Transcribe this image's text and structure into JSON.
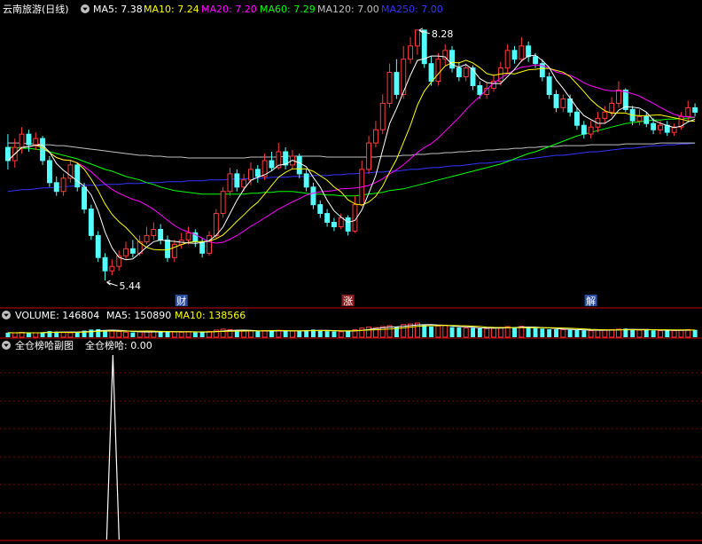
{
  "main": {
    "title": "云南旅游(日线)",
    "indicators": [
      {
        "label": "MA5: 7.38",
        "color": "#ffffff"
      },
      {
        "label": "MA10: 7.24",
        "color": "#ffff00"
      },
      {
        "label": "MA20: 7.20",
        "color": "#ff00ff"
      },
      {
        "label": "MA60: 7.29",
        "color": "#00ff00"
      },
      {
        "label": "MA120: 7.00",
        "color": "#c0c0c0"
      },
      {
        "label": "MA250: 7.00",
        "color": "#3333ff"
      }
    ],
    "high_label": "8.28",
    "low_label": "5.44",
    "markers": [
      {
        "text": "财",
        "bg": "#2b4f9e"
      },
      {
        "text": "涨",
        "bg": "#8b1e1e"
      },
      {
        "text": "解",
        "bg": "#2b4f9e"
      }
    ]
  },
  "volume": {
    "title": "VOLUME: 146804",
    "ma5": "MA5: 150890",
    "ma10": "MA10: 138566"
  },
  "sub": {
    "title": "全仓榜哈副图",
    "value": "全仓榜哈: 0.00"
  },
  "colors": {
    "up": "#ff3b3b",
    "down": "#54ffff",
    "grid": "#7a0000",
    "panel_border": "#c80000"
  },
  "chart_data": {
    "type": "candlestick",
    "y_range": [
      5.3,
      8.4
    ],
    "high": 8.28,
    "low": 5.44,
    "candles": [
      [
        6.95,
        6.8,
        7.1,
        6.7
      ],
      [
        6.8,
        6.95,
        7.05,
        6.72
      ],
      [
        6.95,
        7.1,
        7.18,
        6.88
      ],
      [
        7.1,
        6.98,
        7.15,
        6.9
      ],
      [
        6.98,
        7.05,
        7.12,
        6.92
      ],
      [
        7.05,
        6.8,
        7.08,
        6.75
      ],
      [
        6.8,
        6.55,
        6.85,
        6.5
      ],
      [
        6.55,
        6.45,
        6.62,
        6.4
      ],
      [
        6.45,
        6.6,
        6.65,
        6.4
      ],
      [
        6.6,
        6.75,
        6.8,
        6.55
      ],
      [
        6.75,
        6.5,
        6.78,
        6.45
      ],
      [
        6.5,
        6.25,
        6.55,
        6.2
      ],
      [
        6.25,
        5.95,
        6.3,
        5.9
      ],
      [
        5.95,
        5.7,
        6.0,
        5.65
      ],
      [
        5.7,
        5.55,
        5.75,
        5.44
      ],
      [
        5.55,
        5.6,
        5.68,
        5.5
      ],
      [
        5.6,
        5.72,
        5.78,
        5.55
      ],
      [
        5.72,
        5.8,
        5.88,
        5.68
      ],
      [
        5.8,
        5.75,
        5.9,
        5.7
      ],
      [
        5.75,
        5.88,
        5.95,
        5.72
      ],
      [
        5.88,
        5.95,
        6.05,
        5.85
      ],
      [
        5.95,
        6.02,
        6.1,
        5.9
      ],
      [
        6.02,
        5.9,
        6.08,
        5.85
      ],
      [
        5.9,
        5.7,
        5.95,
        5.65
      ],
      [
        5.7,
        5.85,
        5.9,
        5.65
      ],
      [
        5.85,
        5.9,
        5.98,
        5.8
      ],
      [
        5.9,
        5.98,
        6.05,
        5.85
      ],
      [
        5.98,
        5.88,
        6.02,
        5.82
      ],
      [
        5.88,
        5.75,
        5.92,
        5.7
      ],
      [
        5.75,
        5.95,
        6.0,
        5.72
      ],
      [
        5.95,
        6.2,
        6.25,
        5.92
      ],
      [
        6.2,
        6.45,
        6.5,
        6.15
      ],
      [
        6.45,
        6.65,
        6.72,
        6.4
      ],
      [
        6.65,
        6.5,
        6.7,
        6.45
      ],
      [
        6.5,
        6.58,
        6.65,
        6.45
      ],
      [
        6.58,
        6.7,
        6.78,
        6.52
      ],
      [
        6.7,
        6.62,
        6.75,
        6.55
      ],
      [
        6.62,
        6.8,
        6.88,
        6.58
      ],
      [
        6.8,
        6.72,
        6.9,
        6.68
      ],
      [
        6.72,
        6.9,
        7.0,
        6.7
      ],
      [
        6.9,
        6.75,
        6.95,
        6.7
      ],
      [
        6.75,
        6.85,
        6.92,
        6.7
      ],
      [
        6.85,
        6.65,
        6.88,
        6.6
      ],
      [
        6.65,
        6.5,
        6.7,
        6.45
      ],
      [
        6.5,
        6.3,
        6.55,
        6.25
      ],
      [
        6.3,
        6.2,
        6.35,
        6.15
      ],
      [
        6.2,
        6.1,
        6.25,
        6.05
      ],
      [
        6.1,
        6.05,
        6.15,
        6.0
      ],
      [
        6.05,
        6.15,
        6.2,
        6.02
      ],
      [
        6.15,
        6.0,
        6.18,
        5.95
      ],
      [
        6.0,
        6.3,
        6.4,
        5.98
      ],
      [
        6.3,
        6.7,
        6.8,
        6.28
      ],
      [
        6.7,
        7.0,
        7.08,
        6.65
      ],
      [
        7.0,
        7.15,
        7.25,
        6.95
      ],
      [
        7.15,
        7.45,
        7.55,
        7.1
      ],
      [
        7.45,
        7.8,
        7.9,
        7.4
      ],
      [
        7.8,
        7.55,
        7.95,
        7.5
      ],
      [
        7.55,
        7.95,
        8.1,
        7.5
      ],
      [
        7.95,
        8.1,
        8.2,
        7.9
      ],
      [
        8.1,
        8.28,
        8.28,
        8.0
      ],
      [
        8.28,
        7.9,
        8.28,
        7.85
      ],
      [
        7.9,
        7.7,
        7.98,
        7.65
      ],
      [
        7.7,
        7.95,
        8.02,
        7.65
      ],
      [
        7.95,
        8.05,
        8.12,
        7.88
      ],
      [
        8.05,
        7.85,
        8.1,
        7.8
      ],
      [
        7.85,
        7.75,
        7.92,
        7.7
      ],
      [
        7.75,
        7.85,
        7.9,
        7.7
      ],
      [
        7.85,
        7.65,
        7.88,
        7.6
      ],
      [
        7.65,
        7.55,
        7.7,
        7.5
      ],
      [
        7.55,
        7.62,
        7.68,
        7.5
      ],
      [
        7.62,
        7.7,
        7.78,
        7.58
      ],
      [
        7.7,
        7.85,
        7.92,
        7.65
      ],
      [
        7.85,
        8.05,
        8.12,
        7.8
      ],
      [
        8.05,
        7.95,
        8.1,
        7.9
      ],
      [
        7.95,
        8.1,
        8.2,
        7.92
      ],
      [
        8.1,
        7.98,
        8.15,
        7.92
      ],
      [
        7.98,
        7.9,
        8.02,
        7.85
      ],
      [
        7.9,
        7.75,
        7.95,
        7.7
      ],
      [
        7.75,
        7.55,
        7.8,
        7.5
      ],
      [
        7.55,
        7.4,
        7.6,
        7.35
      ],
      [
        7.4,
        7.5,
        7.55,
        7.35
      ],
      [
        7.5,
        7.35,
        7.55,
        7.3
      ],
      [
        7.35,
        7.2,
        7.4,
        7.15
      ],
      [
        7.2,
        7.1,
        7.25,
        7.05
      ],
      [
        7.1,
        7.18,
        7.25,
        7.05
      ],
      [
        7.18,
        7.28,
        7.35,
        7.12
      ],
      [
        7.28,
        7.35,
        7.42,
        7.22
      ],
      [
        7.35,
        7.45,
        7.52,
        7.3
      ],
      [
        7.45,
        7.6,
        7.7,
        7.4
      ],
      [
        7.6,
        7.38,
        7.62,
        7.35
      ],
      [
        7.38,
        7.25,
        7.42,
        7.2
      ],
      [
        7.25,
        7.3,
        7.38,
        7.2
      ],
      [
        7.3,
        7.22,
        7.35,
        7.18
      ],
      [
        7.22,
        7.15,
        7.28,
        7.1
      ],
      [
        7.15,
        7.2,
        7.25,
        7.1
      ],
      [
        7.2,
        7.12,
        7.25,
        7.08
      ],
      [
        7.12,
        7.18,
        7.22,
        7.08
      ],
      [
        7.18,
        7.3,
        7.35,
        7.15
      ],
      [
        7.3,
        7.4,
        7.48,
        7.25
      ],
      [
        7.4,
        7.35,
        7.45,
        7.3
      ]
    ],
    "ma60": [
      6.95,
      6.95,
      6.94,
      6.94,
      6.93,
      6.92,
      6.9,
      6.88,
      6.86,
      6.84,
      6.82,
      6.79,
      6.76,
      6.73,
      6.7,
      6.68,
      6.65,
      6.62,
      6.6,
      6.58,
      6.55,
      6.53,
      6.5,
      6.48,
      6.46,
      6.45,
      6.44,
      6.43,
      6.42,
      6.42,
      6.42,
      6.42,
      6.42,
      6.42,
      6.42,
      6.43,
      6.43,
      6.44,
      6.44,
      6.45,
      6.45,
      6.45,
      6.44,
      6.43,
      6.42,
      6.42,
      6.41,
      6.41,
      6.4,
      6.4,
      6.4,
      6.41,
      6.42,
      6.43,
      6.44,
      6.46,
      6.47,
      6.48,
      6.5,
      6.52,
      6.54,
      6.56,
      6.58,
      6.6,
      6.62,
      6.64,
      6.66,
      6.68,
      6.7,
      6.72,
      6.74,
      6.76,
      6.79,
      6.82,
      6.85,
      6.88,
      6.9,
      6.93,
      6.96,
      6.99,
      7.02,
      7.05,
      7.08,
      7.1,
      7.12,
      7.14,
      7.16,
      7.18,
      7.2,
      7.22,
      7.23,
      7.24,
      7.25,
      7.26,
      7.26,
      7.27,
      7.27,
      7.28,
      7.28,
      7.29
    ],
    "ma120": [
      7.0,
      7.0,
      7.0,
      6.99,
      6.99,
      6.98,
      6.98,
      6.97,
      6.97,
      6.96,
      6.95,
      6.94,
      6.93,
      6.92,
      6.91,
      6.9,
      6.89,
      6.88,
      6.87,
      6.86,
      6.86,
      6.85,
      6.85,
      6.84,
      6.84,
      6.84,
      6.83,
      6.83,
      6.83,
      6.83,
      6.83,
      6.83,
      6.83,
      6.83,
      6.83,
      6.84,
      6.84,
      6.84,
      6.84,
      6.84,
      6.85,
      6.85,
      6.85,
      6.85,
      6.85,
      6.85,
      6.84,
      6.84,
      6.84,
      6.84,
      6.84,
      6.84,
      6.84,
      6.84,
      6.85,
      6.85,
      6.85,
      6.86,
      6.86,
      6.87,
      6.87,
      6.88,
      6.88,
      6.89,
      6.89,
      6.9,
      6.9,
      6.91,
      6.91,
      6.92,
      6.92,
      6.93,
      6.93,
      6.94,
      6.94,
      6.95,
      6.95,
      6.96,
      6.96,
      6.96,
      6.97,
      6.97,
      6.97,
      6.97,
      6.98,
      6.98,
      6.98,
      6.98,
      6.98,
      6.99,
      6.99,
      6.99,
      6.99,
      6.99,
      7.0,
      7.0,
      7.0,
      7.0,
      7.0,
      7.0
    ],
    "ma250": [
      6.45,
      6.46,
      6.47,
      6.47,
      6.48,
      6.49,
      6.49,
      6.5,
      6.5,
      6.51,
      6.51,
      6.52,
      6.52,
      6.52,
      6.53,
      6.53,
      6.53,
      6.54,
      6.54,
      6.54,
      6.55,
      6.55,
      6.55,
      6.56,
      6.56,
      6.56,
      6.57,
      6.57,
      6.57,
      6.58,
      6.58,
      6.58,
      6.59,
      6.59,
      6.59,
      6.6,
      6.6,
      6.6,
      6.61,
      6.61,
      6.61,
      6.62,
      6.62,
      6.62,
      6.63,
      6.63,
      6.63,
      6.64,
      6.64,
      6.65,
      6.65,
      6.66,
      6.66,
      6.67,
      6.67,
      6.68,
      6.68,
      6.69,
      6.7,
      6.7,
      6.71,
      6.72,
      6.72,
      6.73,
      6.74,
      6.74,
      6.75,
      6.76,
      6.77,
      6.77,
      6.78,
      6.79,
      6.8,
      6.81,
      6.81,
      6.82,
      6.83,
      6.84,
      6.85,
      6.86,
      6.86,
      6.87,
      6.88,
      6.89,
      6.9,
      6.9,
      6.91,
      6.92,
      6.93,
      6.94,
      6.94,
      6.95,
      6.96,
      6.97,
      6.97,
      6.98,
      6.98,
      6.99,
      6.99,
      7.0
    ],
    "volume": [
      90,
      85,
      95,
      80,
      88,
      100,
      120,
      110,
      95,
      90,
      105,
      130,
      150,
      160,
      140,
      120,
      110,
      100,
      95,
      105,
      110,
      115,
      100,
      120,
      105,
      100,
      110,
      95,
      100,
      115,
      140,
      160,
      150,
      130,
      120,
      125,
      115,
      130,
      120,
      135,
      125,
      120,
      130,
      140,
      150,
      130,
      120,
      115,
      110,
      125,
      150,
      180,
      200,
      190,
      210,
      230,
      200,
      250,
      260,
      280,
      240,
      210,
      220,
      230,
      200,
      190,
      180,
      185,
      175,
      170,
      180,
      190,
      210,
      200,
      215,
      190,
      180,
      170,
      160,
      155,
      150,
      145,
      140,
      135,
      130,
      140,
      145,
      150,
      160,
      170,
      150,
      140,
      145,
      135,
      130,
      138,
      132,
      140,
      150,
      146
    ],
    "sub_spike": {
      "index": 15,
      "value": 1
    },
    "marker_index": [
      25,
      49,
      84
    ]
  }
}
